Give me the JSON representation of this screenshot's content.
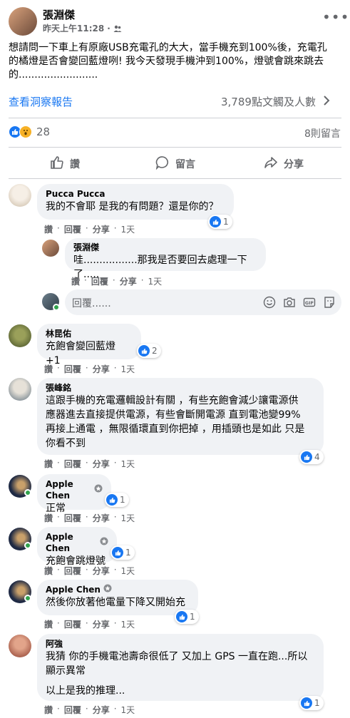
{
  "post": {
    "author": "張淵傑",
    "time": "昨天上午11:28",
    "privacy_sep": "·",
    "text_lines": [
      "想請問一下車上有原廠USB充電孔的大大，當手機充到100%後，充電孔",
      "的橘燈是否會變回藍燈咧! 我今天發現手機沖到100%，燈號會跳來跳去",
      "的........................."
    ],
    "insights_link": "查看洞察報告",
    "reach_text": "3,789點文觸及人數",
    "reaction_count": "28",
    "comment_count": "8則留言"
  },
  "actions": {
    "like": "讚",
    "comment": "留言",
    "share": "分享"
  },
  "comment_meta": {
    "like": "讚",
    "reply": "回覆",
    "share": "分享",
    "sep": "·"
  },
  "comments": [
    {
      "name": "Pucca Pucca",
      "text": "我的不會耶 是我的有問題？還是你的？",
      "time": "1天",
      "reactions": "1"
    },
    {
      "name": "張淵傑",
      "text": "哇.................那我是否要回去處理一下了.....",
      "time": "1天",
      "reactions": ""
    },
    {
      "name": "林昆佑",
      "text": "充飽會變回藍燈 +1",
      "time": "1天",
      "reactions": "2"
    },
    {
      "name": "張峰銘",
      "text_lines": [
        "這跟手機的充電邏輯設計有關 ，有些充飽會減少讓電源供",
        "應器進去直接提供電源，有些會斷開電源 直到電池變99%",
        "再接上通電 ，無限循環直到你把掉 ，用插頭也是如此 只是",
        "你看不到"
      ],
      "time": "1天",
      "reactions": "4"
    },
    {
      "name": "Apple Chen",
      "text": "正常",
      "time": "1天",
      "reactions": "1"
    },
    {
      "name": "Apple Chen",
      "text": "充飽會跳燈號",
      "time": "1天",
      "reactions": "1"
    },
    {
      "name": "Apple Chen",
      "text": "然後你放著他電量下降又開始充",
      "time": "1天",
      "reactions": "1"
    },
    {
      "name": "阿強",
      "text_lines": [
        "我猜 你的手機電池壽命很低了 又加上 GPS 一直在跑...所以",
        "顯示異常",
        "以上是我的推理..."
      ],
      "time": "1天",
      "reactions": "1"
    }
  ],
  "reply_box": {
    "placeholder": "回覆......"
  },
  "colors": {
    "accent": "#1877f2",
    "muted": "#65676b",
    "bubble": "#f0f2f5"
  }
}
